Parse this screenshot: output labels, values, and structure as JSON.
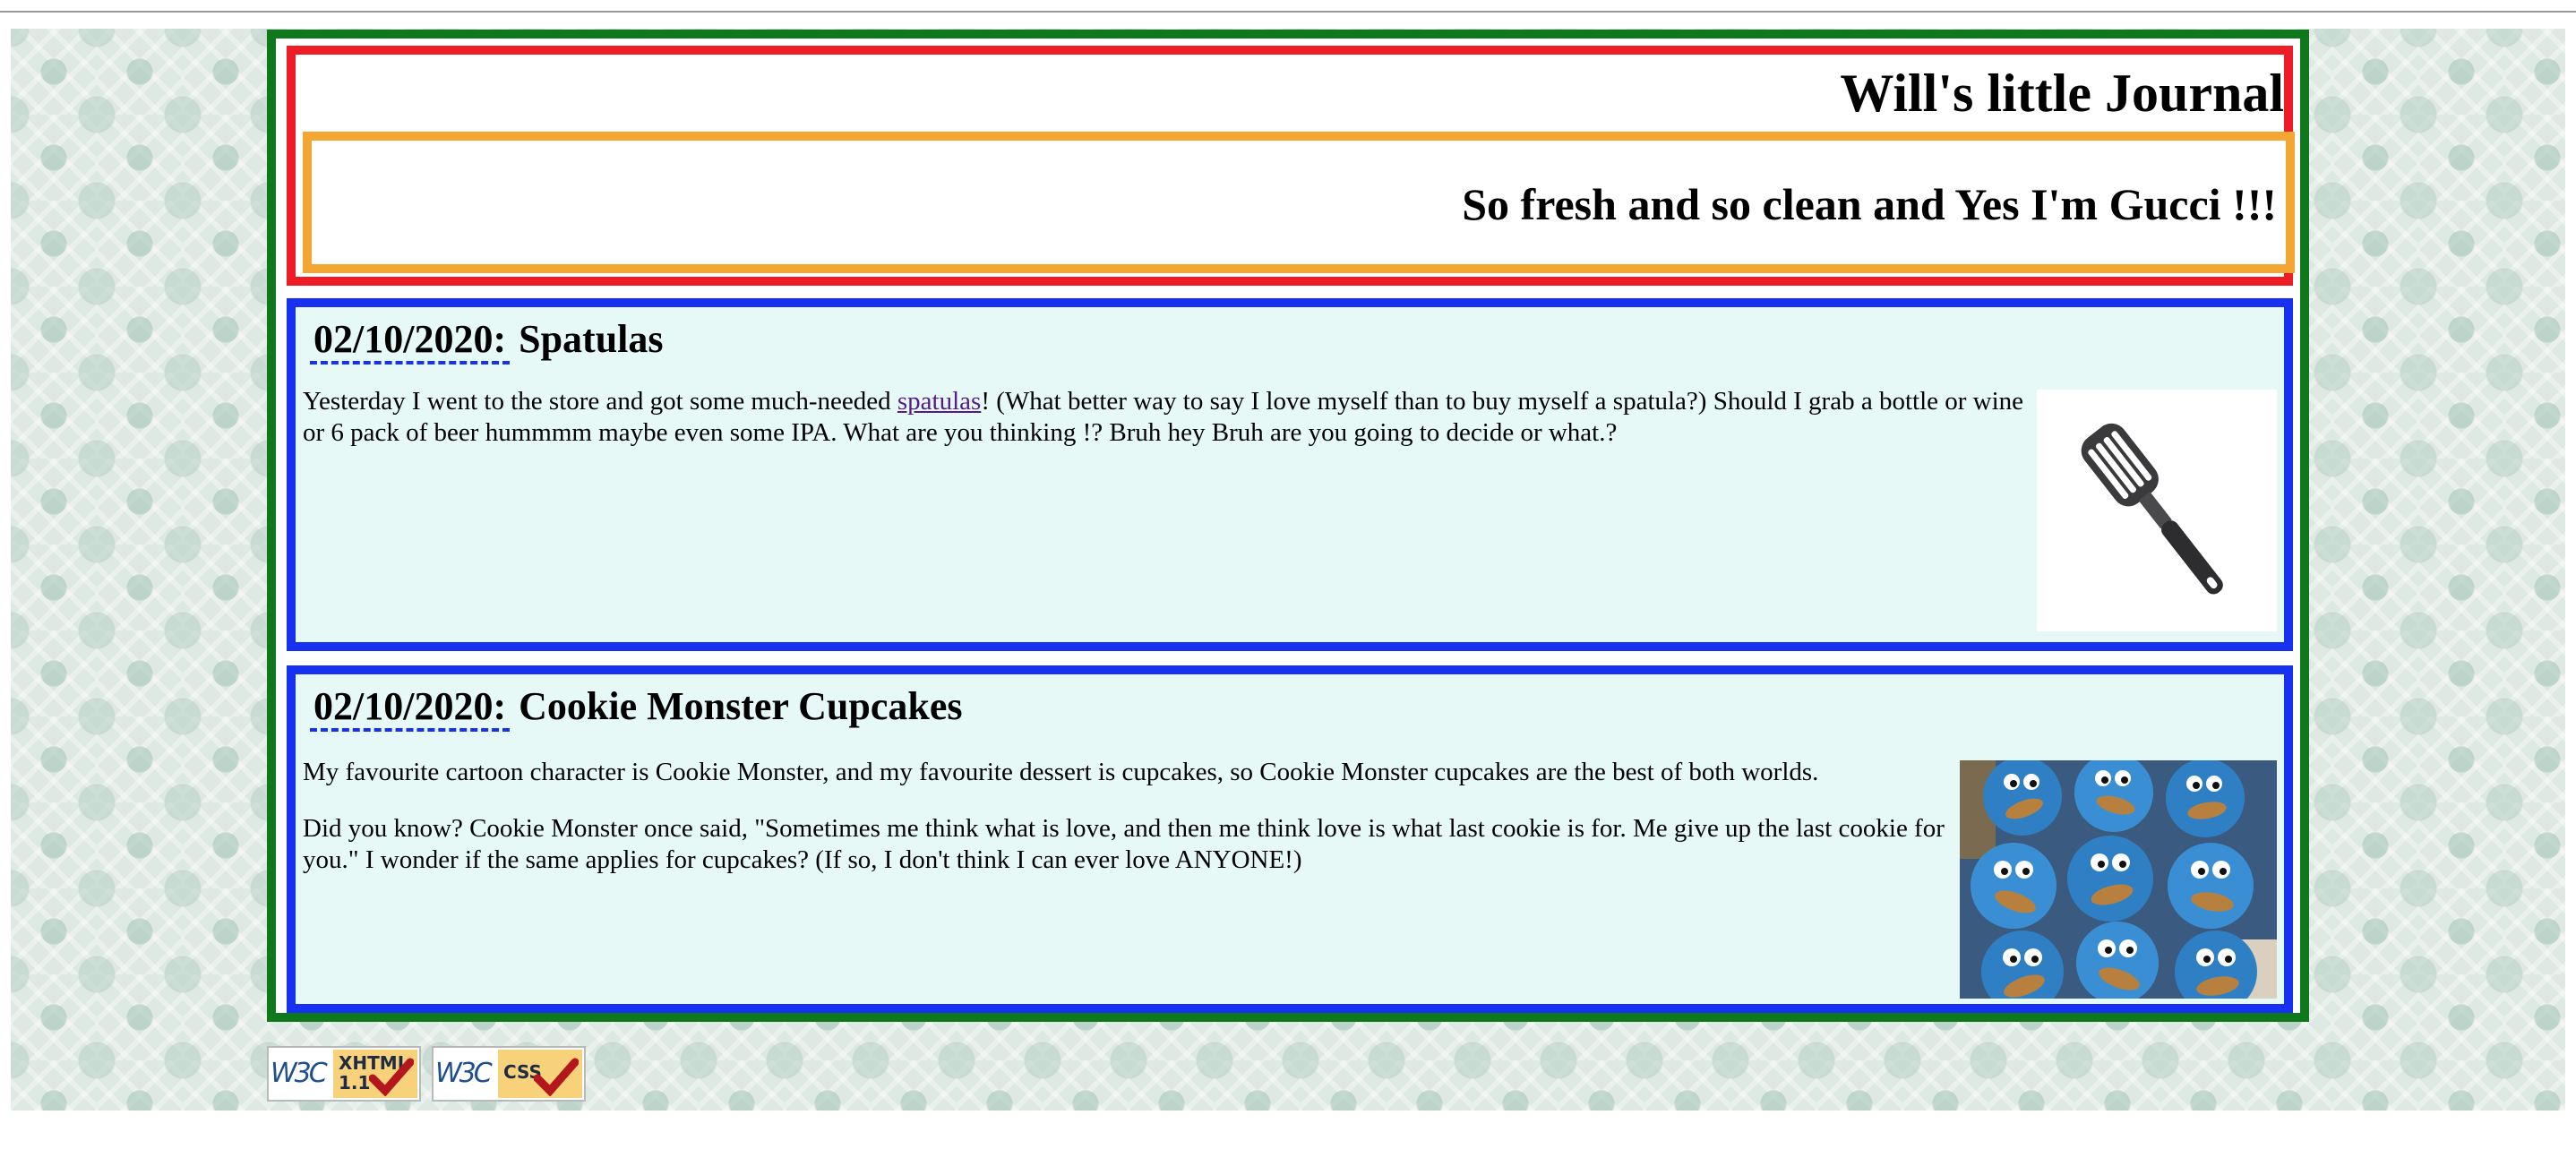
{
  "header": {
    "title": "Will's little Journal",
    "tagline": "So fresh and so clean and Yes I'm Gucci !!!"
  },
  "entries": [
    {
      "date": "02/10/2020:",
      "title": "Spatulas",
      "body_before_link": "Yesterday I went to the store and got some much-needed ",
      "link_text": "spatulas",
      "body_after_link": "! (What better way to say I love myself than to buy myself a spatula?) Should I grab a bottle or wine or 6 pack of beer hummmm maybe even some IPA. What are you thinking !? Bruh hey Bruh are you going to decide or what.?",
      "image": "spatula-photo"
    },
    {
      "date": "02/10/2020:",
      "title": "Cookie Monster Cupcakes",
      "paragraphs": [
        "My favourite cartoon character is Cookie Monster, and my favourite dessert is cupcakes, so Cookie Monster cupcakes are the best of both worlds.",
        "Did you know? Cookie Monster once said, \"Sometimes me think what is love, and then me think love is what last cookie is for. Me give up the last cookie for you.\" I wonder if the same applies for cupcakes? (If so, I don't think I can ever love ANYONE!)"
      ],
      "image": "cookie-monster-cupcakes-photo"
    }
  ],
  "badges": [
    {
      "name": "w3c-xhtml-badge",
      "w3c": "W3C",
      "label": "XHTML\n1.1"
    },
    {
      "name": "w3c-css-badge",
      "w3c": "W3C",
      "label": "CSS"
    }
  ],
  "colors": {
    "page_frame": "#10781c",
    "header_border": "#ee1c25",
    "tagline_border": "#f4a632",
    "entry_border": "#1731f0",
    "entry_background": "#e6f9f7",
    "visited_link": "#551a8b"
  }
}
